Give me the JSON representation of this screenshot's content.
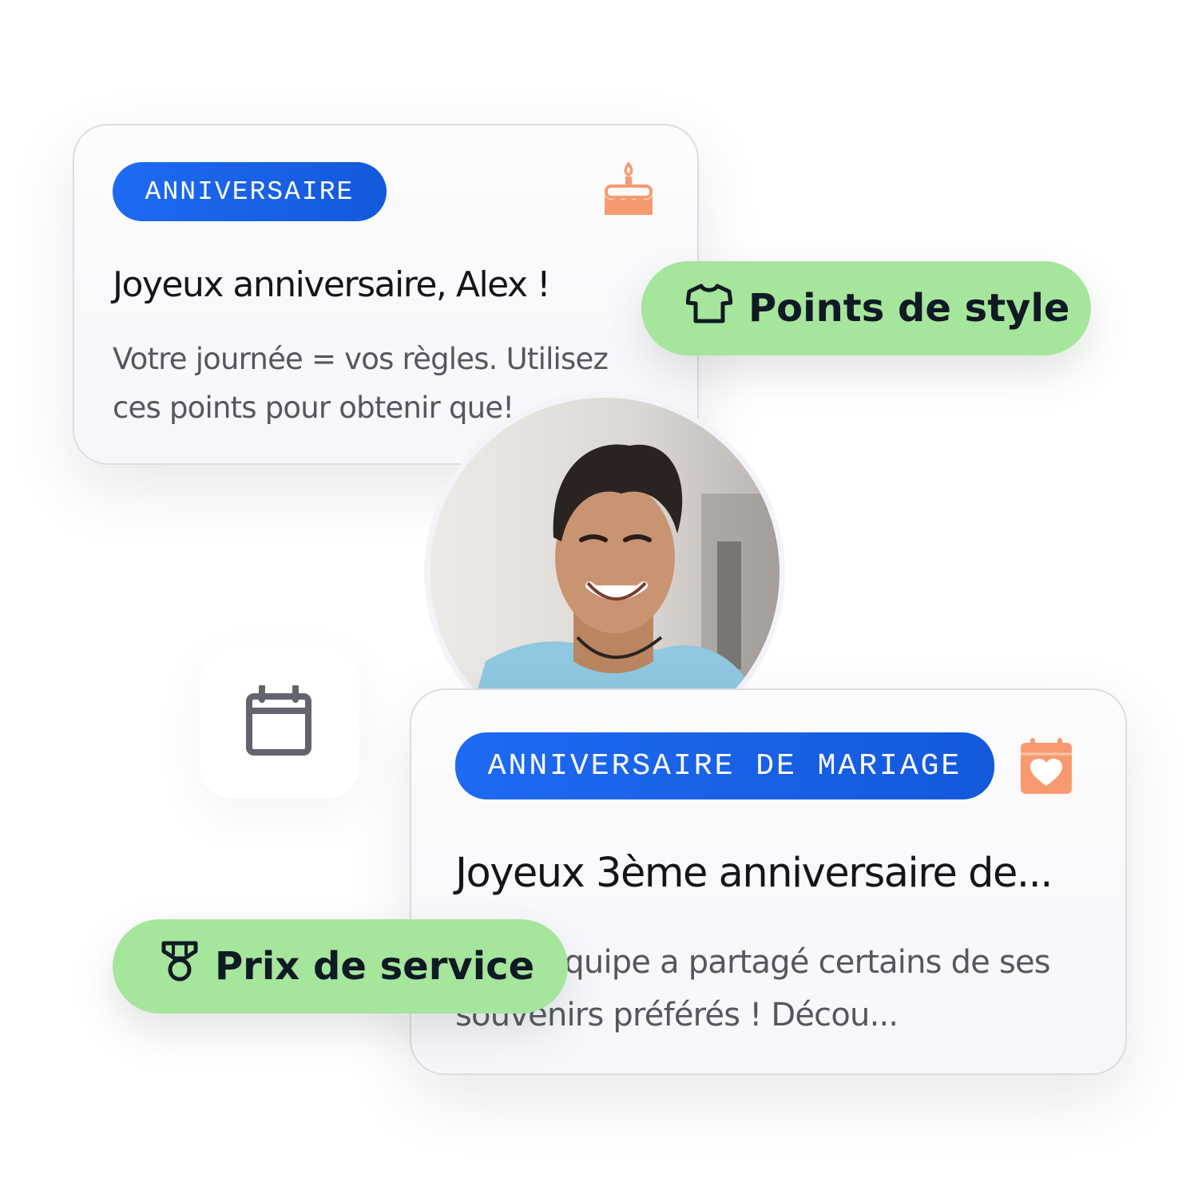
{
  "birthday_card": {
    "tag": "ANNIVERSAIRE",
    "title": "Joyeux anniversaire, Alex !",
    "body": "Votre journée = vos règles. Utilisez ces points pour obtenir que!",
    "icon": "birthday-cake-icon"
  },
  "style_pill": {
    "label": "Points de style",
    "icon": "t-shirt-icon"
  },
  "avatar": {
    "icon": "person-photo"
  },
  "calendar": {
    "icon": "calendar-icon"
  },
  "wedding_card": {
    "tag": "ANNIVERSAIRE DE MARIAGE",
    "title": "Joyeux 3ème anniversaire de...",
    "body": "Votre équipe a partagé certains de ses souvenirs préférés ! Décou...",
    "icon": "heart-calendar-icon"
  },
  "service_pill": {
    "label": "Prix de service",
    "icon": "medal-icon"
  },
  "colors": {
    "tag_blue": "#1e6af2",
    "pill_green": "#a6e59c",
    "icon_orange": "#f89a70",
    "text_dark": "#14151c"
  }
}
